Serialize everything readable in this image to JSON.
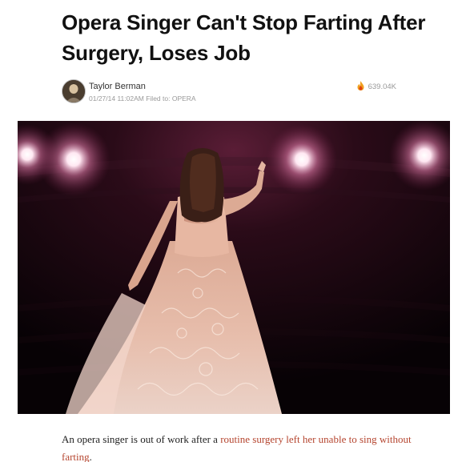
{
  "article": {
    "headline": "Opera Singer Can't Stop Farting After Surgery, Loses Job",
    "author": "Taylor Berman",
    "date": "01/27/14 11:02AM",
    "filed_prefix": "Filed to:",
    "filed_tag": "OPERA",
    "views": "639.04K",
    "views_icon": "flame-icon",
    "author_icon": "avatar",
    "body_before_link": "An opera singer is out of work after a ",
    "body_link": "routine surgery left her unable to sing without farting",
    "body_after_link": ".",
    "colors": {
      "headline": "#111111",
      "link": "#b5452f",
      "meta": "#999999",
      "flame": "#f0a020"
    }
  }
}
